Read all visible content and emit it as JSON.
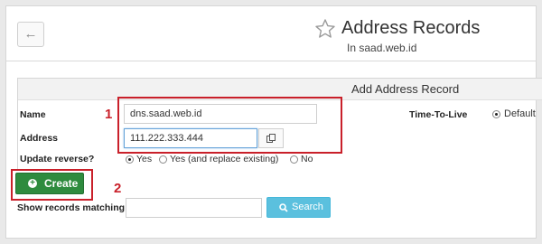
{
  "header": {
    "title": "Address Records",
    "subtitle": "In saad.web.id",
    "back_icon": "arrow-left-icon",
    "star_icon": "star-icon"
  },
  "form": {
    "section_title": "Add Address Record",
    "name_label": "Name",
    "name_value": "dns.saad.web.id",
    "address_label": "Address",
    "address_value": "111.222.333.444",
    "ttl_label": "Time-To-Live",
    "ttl_option": "Default",
    "reverse_label": "Update reverse?",
    "reverse_options": [
      "Yes",
      "Yes (and replace existing)",
      "No"
    ],
    "reverse_selected": "Yes"
  },
  "annotations": {
    "marker_1": "1",
    "marker_2": "2",
    "color": "#c9202a"
  },
  "actions": {
    "create_label": "Create",
    "search_label": "Search"
  },
  "search": {
    "label": "Show records matching:",
    "value": ""
  },
  "colors": {
    "create_button": "#2e8b3e",
    "search_button": "#5bc0de",
    "focus_border": "#66a3d9"
  }
}
